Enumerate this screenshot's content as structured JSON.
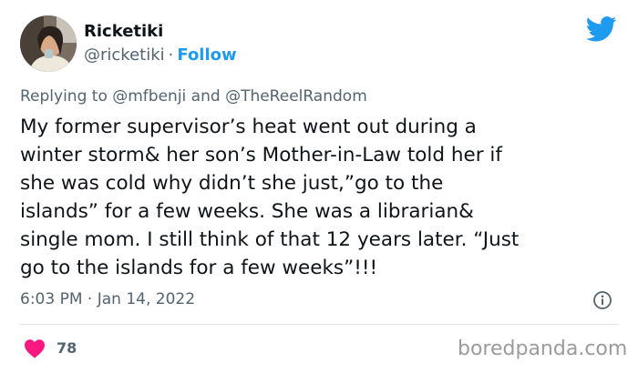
{
  "tweet": {
    "author": {
      "name": "Ricketiki",
      "handle": "@ricketiki",
      "separator": "·",
      "follow_label": "Follow"
    },
    "replying_prefix": "Replying to",
    "replying_to": [
      "@mfbenji",
      "@TheReelRandom"
    ],
    "replying_joiner": "and",
    "body_lines": [
      "My former supervisor’s heat went out during a",
      "winter storm& her son’s Mother-in-Law told her if",
      "she was cold why didn’t she just,”go to the",
      "islands” for a few weeks. She was a librarian&",
      "single mom. I still think of that 12 years later. “Just",
      "go to the islands for a few weeks”!!!"
    ],
    "time": "6:03 PM",
    "date_separator": "·",
    "date": "Jan 14, 2022",
    "like_count": "78"
  },
  "watermark": "boredpanda.com",
  "colors": {
    "twitter_blue": "#1d9bf0",
    "text_primary": "#0f1419",
    "text_secondary": "#536471",
    "like_pink": "#f91880",
    "divider": "#dfe3e6",
    "watermark_gray": "#9b9b9b"
  },
  "icons": {
    "logo": "twitter-bird-icon",
    "like": "heart-icon",
    "info": "info-icon"
  }
}
